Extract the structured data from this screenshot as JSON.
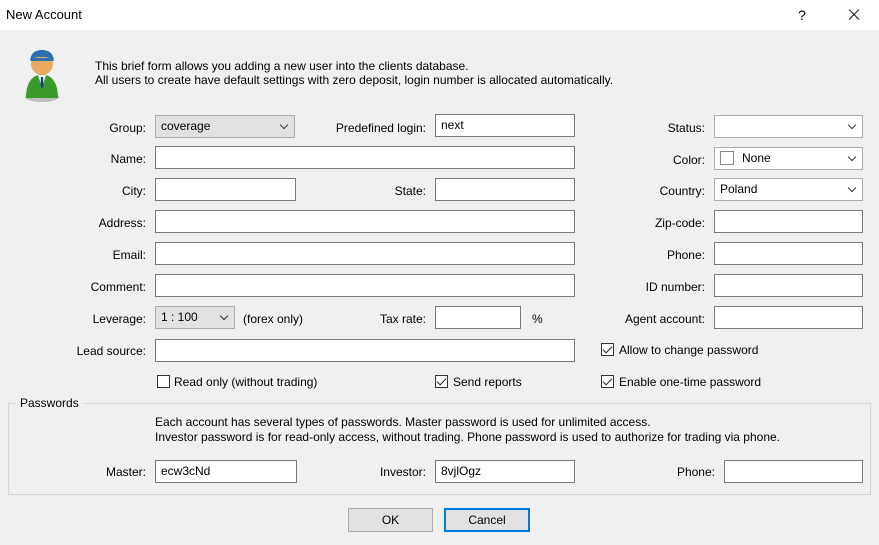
{
  "window": {
    "title": "New Account",
    "help_label": "?"
  },
  "intro": {
    "line1": "This brief form allows you adding a new user into the clients database.",
    "line2": "All users to create have default settings with zero deposit, login number is allocated automatically."
  },
  "form": {
    "group": {
      "label": "Group:",
      "value": "coverage"
    },
    "predefined_login": {
      "label": "Predefined login:",
      "value": "next"
    },
    "status": {
      "label": "Status:",
      "value": ""
    },
    "name": {
      "label": "Name:",
      "value": ""
    },
    "color": {
      "label": "Color:",
      "value": "None"
    },
    "city": {
      "label": "City:",
      "value": ""
    },
    "state": {
      "label": "State:",
      "value": ""
    },
    "country": {
      "label": "Country:",
      "value": "Poland"
    },
    "address": {
      "label": "Address:",
      "value": ""
    },
    "zip": {
      "label": "Zip-code:",
      "value": ""
    },
    "email": {
      "label": "Email:",
      "value": ""
    },
    "phone": {
      "label": "Phone:",
      "value": ""
    },
    "comment": {
      "label": "Comment:",
      "value": ""
    },
    "id_number": {
      "label": "ID number:",
      "value": ""
    },
    "leverage": {
      "label": "Leverage:",
      "value": "1 : 100",
      "note": "(forex only)"
    },
    "tax_rate": {
      "label": "Tax rate:",
      "value": "",
      "unit": "%"
    },
    "agent_account": {
      "label": "Agent account:",
      "value": ""
    },
    "lead_source": {
      "label": "Lead source:",
      "value": ""
    }
  },
  "checkboxes": {
    "allow_change_password": {
      "label": "Allow to change password",
      "checked": true
    },
    "read_only": {
      "label": "Read only (without trading)",
      "checked": false
    },
    "send_reports": {
      "label": "Send reports",
      "checked": true
    },
    "one_time_password": {
      "label": "Enable one-time password",
      "checked": true
    }
  },
  "passwords": {
    "legend": "Passwords",
    "info_line1": "Each account has several types of passwords. Master password is used for unlimited access.",
    "info_line2": "Investor password is for read-only access, without trading. Phone password is used to authorize for trading via phone.",
    "master": {
      "label": "Master:",
      "value": "ecw3cNd"
    },
    "investor": {
      "label": "Investor:",
      "value": "8vjlOgz"
    },
    "phone": {
      "label": "Phone:",
      "value": ""
    }
  },
  "buttons": {
    "ok": "OK",
    "cancel": "Cancel"
  },
  "icons": {
    "avatar": "user-avatar-icon",
    "close": "close-icon",
    "chevron": "chevron-down-icon"
  },
  "colors": {
    "accent": "#0078d7",
    "avatar_body": "#3a9a2a",
    "avatar_head": "#e8a860"
  }
}
